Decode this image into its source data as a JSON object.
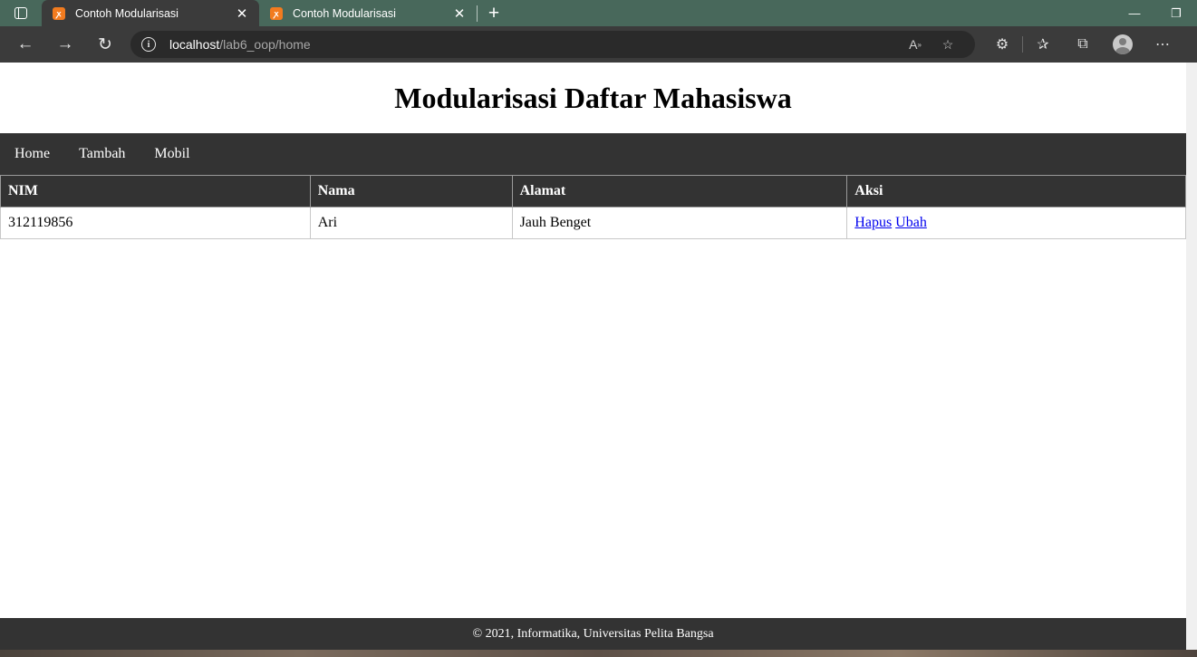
{
  "browser": {
    "tabs": [
      {
        "title": "Contoh Modularisasi",
        "active": true
      },
      {
        "title": "Contoh Modularisasi",
        "active": false
      }
    ],
    "url_host": "localhost",
    "url_path": "/lab6_oop/home"
  },
  "page": {
    "title": "Modularisasi Daftar Mahasiswa",
    "nav": [
      "Home",
      "Tambah",
      "Mobil"
    ],
    "table": {
      "headers": [
        "NIM",
        "Nama",
        "Alamat",
        "Aksi"
      ],
      "rows": [
        {
          "nim": "312119856",
          "nama": "Ari",
          "alamat": "Jauh Benget",
          "actions": [
            "Hapus",
            "Ubah"
          ]
        }
      ]
    },
    "footer": "© 2021, Informatika, Universitas Pelita Bangsa"
  },
  "colors": {
    "tabbar": "#48685b",
    "toolbar": "#3b3b3b",
    "nav_bg": "#333333",
    "link": "#0000ee",
    "favicon": "#f27b1f"
  },
  "icons": [
    "sidebar-icon",
    "xampp-favicon-icon",
    "close-icon",
    "plus-icon",
    "minimize-icon",
    "restore-icon",
    "back-arrow-icon",
    "forward-arrow-icon",
    "reload-icon",
    "info-icon",
    "read-aloud-icon",
    "add-favorite-icon",
    "extensions-icon",
    "favorites-icon",
    "collections-icon",
    "profile-icon",
    "more-icon"
  ]
}
